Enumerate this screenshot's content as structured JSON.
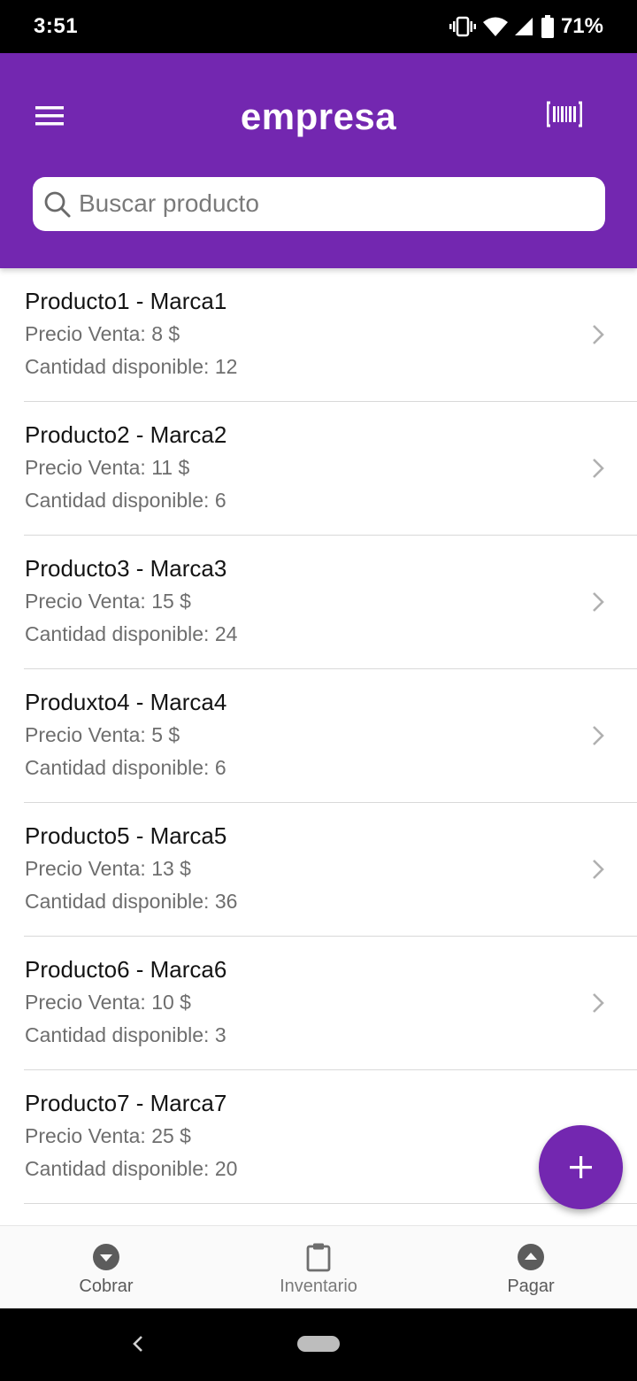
{
  "status_bar": {
    "time": "3:51",
    "battery": "71%"
  },
  "app_bar": {
    "title": "empresa"
  },
  "search": {
    "placeholder": "Buscar producto"
  },
  "products": [
    {
      "name": "Producto1 - Marca1",
      "price": "Precio Venta: 8 $",
      "qty": "Cantidad disponible: 12"
    },
    {
      "name": "Producto2 - Marca2",
      "price": "Precio Venta: 11 $",
      "qty": "Cantidad disponible: 6"
    },
    {
      "name": "Producto3 - Marca3",
      "price": "Precio Venta: 15 $",
      "qty": "Cantidad disponible: 24"
    },
    {
      "name": "Produxto4 - Marca4",
      "price": "Precio Venta: 5 $",
      "qty": "Cantidad disponible: 6"
    },
    {
      "name": "Producto5 - Marca5",
      "price": "Precio Venta: 13 $",
      "qty": "Cantidad disponible: 36"
    },
    {
      "name": "Producto6 - Marca6",
      "price": "Precio Venta: 10 $",
      "qty": "Cantidad disponible: 3"
    },
    {
      "name": "Producto7 - Marca7",
      "price": "Precio Venta: 25 $",
      "qty": "Cantidad disponible: 20"
    }
  ],
  "bottom_nav": [
    {
      "label": "Cobrar",
      "icon": "arrow-down-circle-icon"
    },
    {
      "label": "Inventario",
      "icon": "clipboard-icon"
    },
    {
      "label": "Pagar",
      "icon": "arrow-up-circle-icon"
    }
  ],
  "colors": {
    "primary": "#7327b0",
    "background": "#ffffff"
  }
}
